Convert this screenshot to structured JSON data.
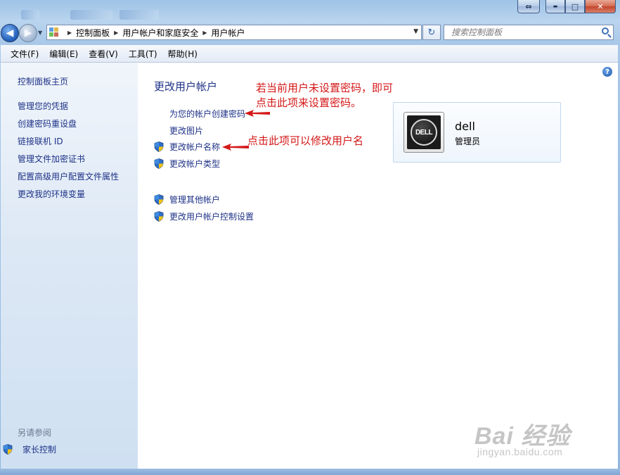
{
  "window": {
    "caption_buttons": {
      "resize_icon": "⇔",
      "minimize_icon": "▬",
      "maximize_icon": "□",
      "close_icon": "✕"
    }
  },
  "address_bar": {
    "breadcrumbs": [
      "控制面板",
      "用户帐户和家庭安全",
      "用户帐户"
    ],
    "search_placeholder": "搜索控制面板"
  },
  "menu": [
    "文件(F)",
    "编辑(E)",
    "查看(V)",
    "工具(T)",
    "帮助(H)"
  ],
  "sidebar": {
    "links": [
      "控制面板主页",
      "管理您的凭据",
      "创建密码重设盘",
      "链接联机 ID",
      "管理文件加密证书",
      "配置高级用户配置文件属性",
      "更改我的环境变量"
    ],
    "see_also_title": "另请参阅",
    "see_also_links": [
      "家长控制"
    ]
  },
  "main": {
    "heading": "更改用户帐户",
    "tasks": [
      "为您的帐户创建密码",
      "更改图片",
      "更改帐户名称",
      "更改帐户类型"
    ],
    "other_tasks": [
      "管理其他帐户",
      "更改用户帐户控制设置"
    ]
  },
  "account": {
    "name": "dell",
    "role": "管理员",
    "logo_text": "DELL"
  },
  "annotations": {
    "note_password_line1": "若当前用户未设置密码，即可",
    "note_password_line2": "点击此项来设置密码。",
    "note_rename": "点击此项可以修改用户名",
    "color": "#d41818"
  },
  "watermark": {
    "main": "Bai 经验",
    "sub": "jingyan.baidu.com"
  },
  "colors": {
    "link": "#1e3287",
    "sidebar_bg": "#dde8f5",
    "frame": "#a9c8e8"
  }
}
